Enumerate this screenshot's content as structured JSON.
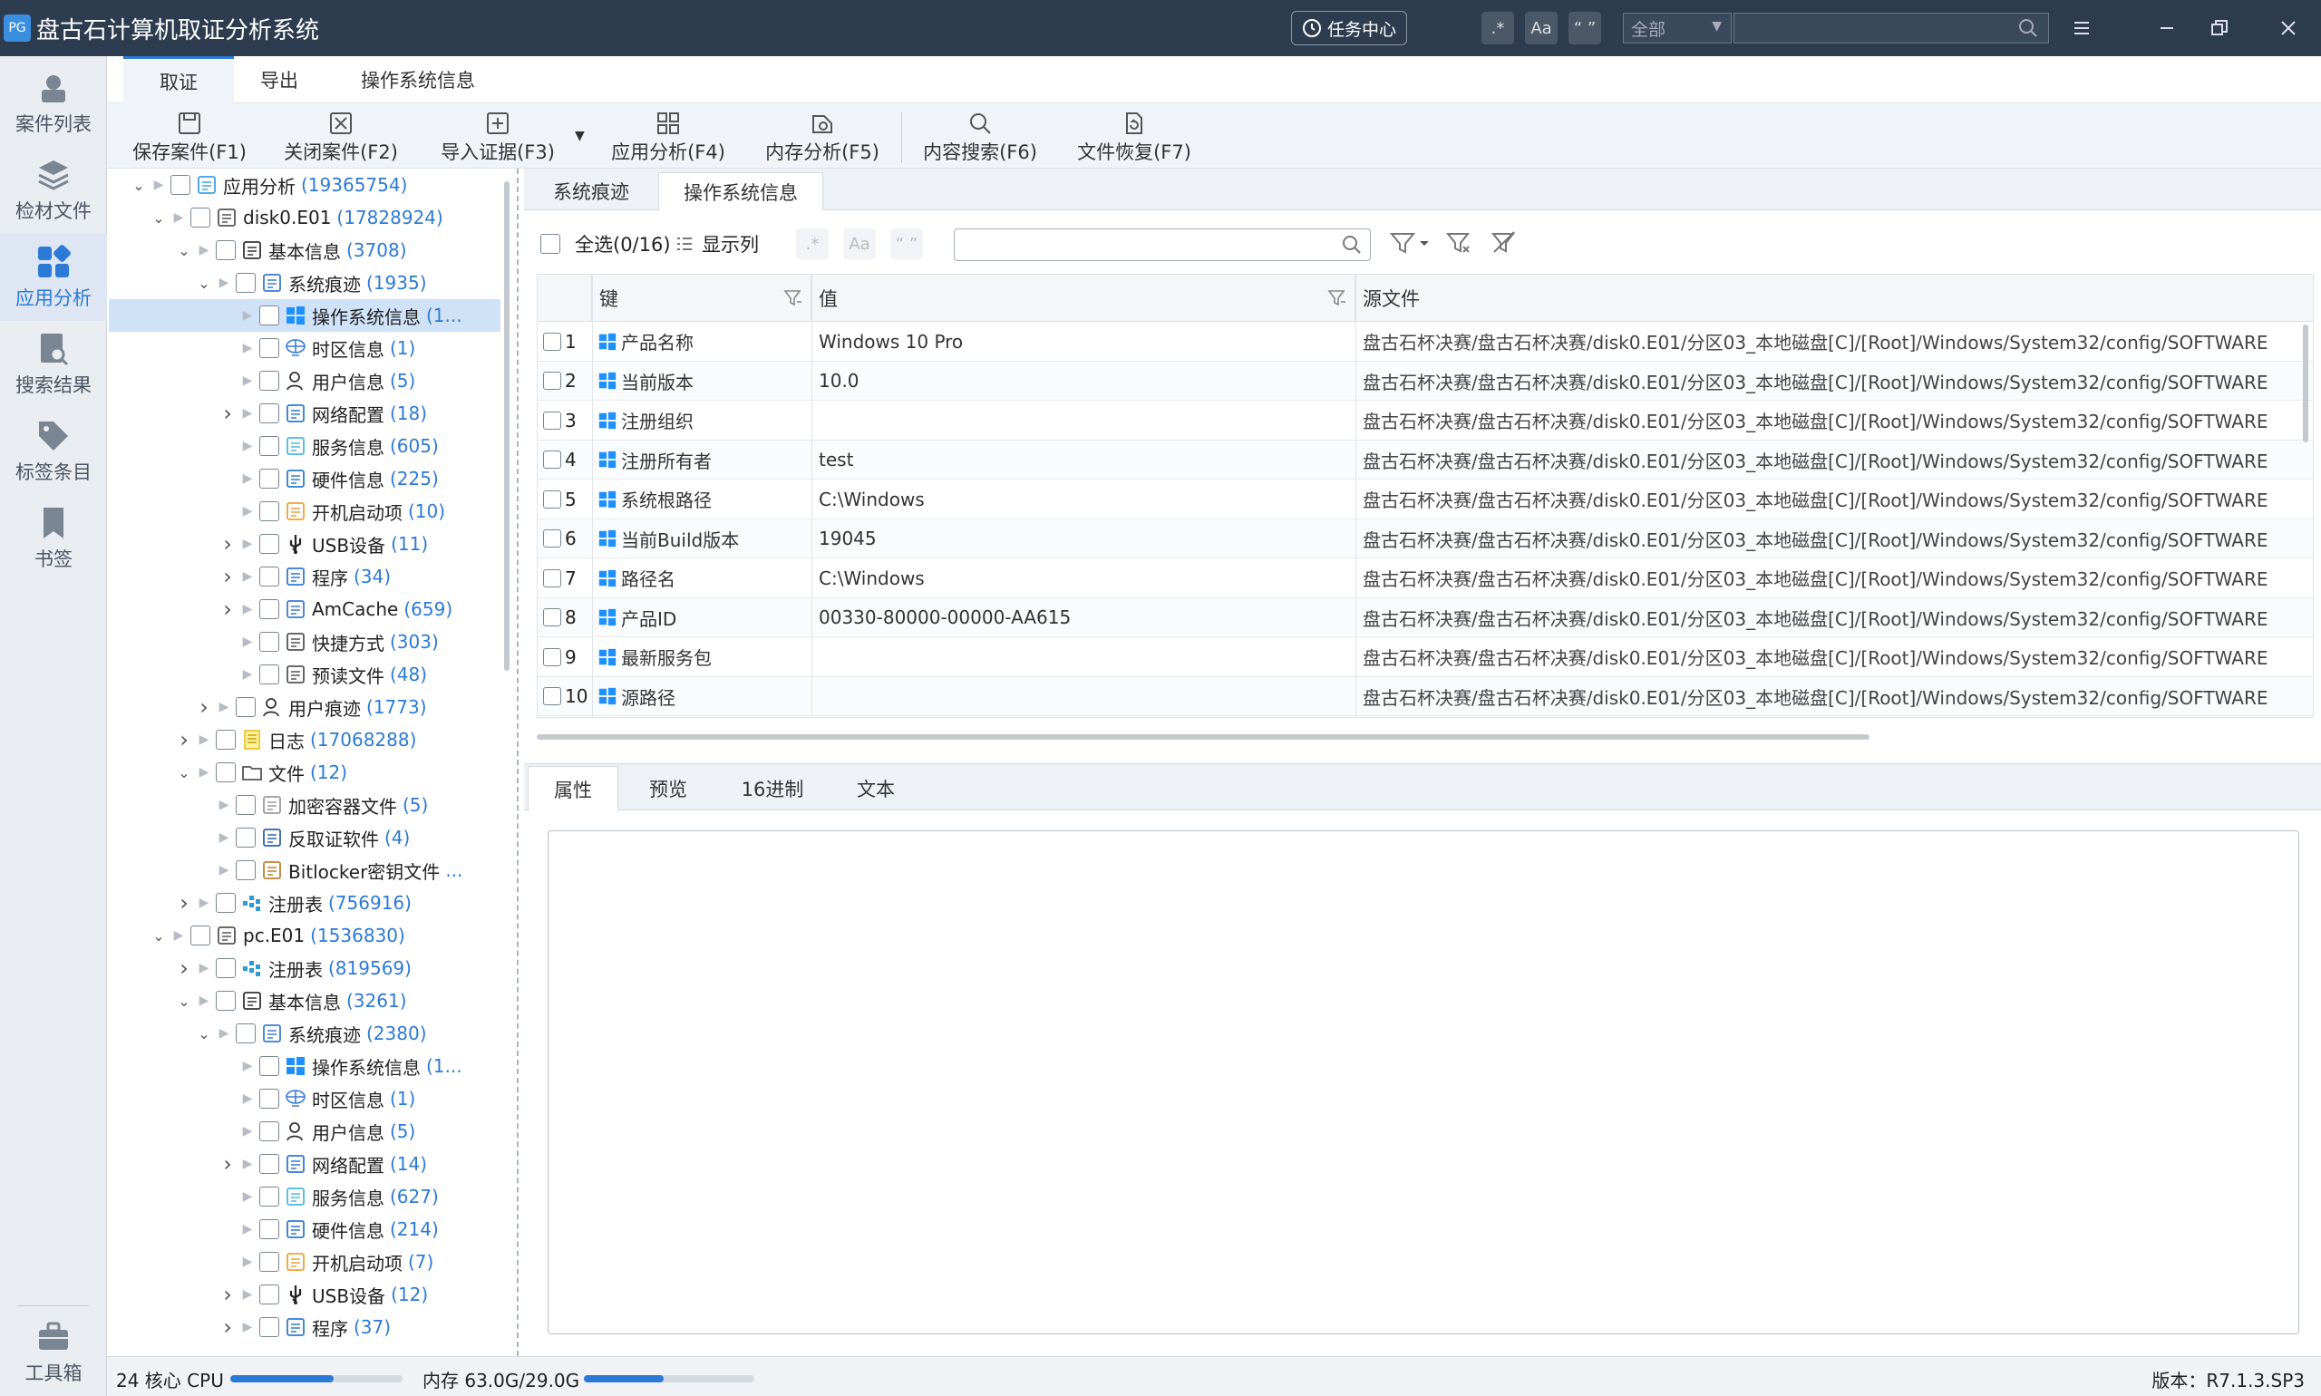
{
  "app": {
    "title": "盘古石计算机取证分析系统",
    "logo": "PG"
  },
  "titlebar": {
    "task_center": "任务中心",
    "opt_regex": ".*",
    "opt_case": "Aa",
    "opt_word": "“ ”",
    "scope": "全部",
    "search_value": ""
  },
  "leftnav": [
    {
      "label": "案件列表",
      "icon": "case-list-icon"
    },
    {
      "label": "检材文件",
      "icon": "layers-icon"
    },
    {
      "label": "应用分析",
      "icon": "apps-icon"
    },
    {
      "label": "搜索结果",
      "icon": "search-result-icon"
    },
    {
      "label": "标签条目",
      "icon": "tag-icon"
    },
    {
      "label": "书签",
      "icon": "bookmark-icon"
    },
    {
      "label": "工具箱",
      "icon": "toolbox-icon"
    }
  ],
  "ribbon": {
    "tabs": [
      "取证",
      "导出",
      "操作系统信息"
    ],
    "tools": [
      "保存案件(F1)",
      "关闭案件(F2)",
      "导入证据(F3)",
      "应用分析(F4)",
      "内存分析(F5)",
      "内容搜索(F6)",
      "文件恢复(F7)"
    ]
  },
  "tree": [
    {
      "label": "应用分析",
      "count": "(19365754)",
      "icon": "app-analysis-icon",
      "exp": "v"
    },
    {
      "label": "disk0.E01",
      "count": "(17828924)",
      "icon": "disk-image-icon",
      "exp": "v"
    },
    {
      "label": "基本信息",
      "count": "(3708)",
      "icon": "basic-info-icon",
      "exp": "v"
    },
    {
      "label": "系统痕迹",
      "count": "(1935)",
      "icon": "system-trace-icon",
      "exp": "v"
    },
    {
      "label": "操作系统信息",
      "count": "(1...",
      "icon": "windows-icon",
      "exp": ""
    },
    {
      "label": "时区信息",
      "count": "(1)",
      "icon": "globe-icon",
      "exp": ""
    },
    {
      "label": "用户信息",
      "count": "(5)",
      "icon": "user-icon",
      "exp": ""
    },
    {
      "label": "网络配置",
      "count": "(18)",
      "icon": "monitor-icon",
      "exp": ">"
    },
    {
      "label": "服务信息",
      "count": "(605)",
      "icon": "service-icon",
      "exp": ""
    },
    {
      "label": "硬件信息",
      "count": "(225)",
      "icon": "hardware-icon",
      "exp": ""
    },
    {
      "label": "开机启动项",
      "count": "(10)",
      "icon": "startup-icon",
      "exp": ""
    },
    {
      "label": "USB设备",
      "count": "(11)",
      "icon": "usb-icon",
      "exp": ">"
    },
    {
      "label": "程序",
      "count": "(34)",
      "icon": "program-icon",
      "exp": ">"
    },
    {
      "label": "AmCache",
      "count": "(659)",
      "icon": "amcache-icon",
      "exp": ">"
    },
    {
      "label": "快捷方式",
      "count": "(303)",
      "icon": "shortcut-icon",
      "exp": ""
    },
    {
      "label": "预读文件",
      "count": "(48)",
      "icon": "prefetch-icon",
      "exp": ""
    },
    {
      "label": "用户痕迹",
      "count": "(1773)",
      "icon": "user-trace-icon",
      "exp": ">"
    },
    {
      "label": "日志",
      "count": "(17068288)",
      "icon": "log-icon",
      "exp": ">"
    },
    {
      "label": "文件",
      "count": "(12)",
      "icon": "folder-icon",
      "exp": "v"
    },
    {
      "label": "加密容器文件",
      "count": "(5)",
      "icon": "lock-icon",
      "exp": ""
    },
    {
      "label": "反取证软件",
      "count": "(4)",
      "icon": "anti-forensic-icon",
      "exp": ""
    },
    {
      "label": "Bitlocker密钥文件",
      "count": "...",
      "icon": "key-icon",
      "exp": ""
    },
    {
      "label": "注册表",
      "count": "(756916)",
      "icon": "registry-icon",
      "exp": ">"
    },
    {
      "label": "pc.E01",
      "count": "(1536830)",
      "icon": "disk-image-icon",
      "exp": "v"
    },
    {
      "label": "注册表",
      "count": "(819569)",
      "icon": "registry-icon",
      "exp": ">"
    },
    {
      "label": "基本信息",
      "count": "(3261)",
      "icon": "basic-info-icon",
      "exp": "v"
    },
    {
      "label": "系统痕迹",
      "count": "(2380)",
      "icon": "system-trace-icon",
      "exp": "v"
    },
    {
      "label": "操作系统信息",
      "count": "(1...",
      "icon": "windows-icon",
      "exp": ""
    },
    {
      "label": "时区信息",
      "count": "(1)",
      "icon": "globe-icon",
      "exp": ""
    },
    {
      "label": "用户信息",
      "count": "(5)",
      "icon": "user-icon",
      "exp": ""
    },
    {
      "label": "网络配置",
      "count": "(14)",
      "icon": "monitor-icon",
      "exp": ">"
    },
    {
      "label": "服务信息",
      "count": "(627)",
      "icon": "service-icon",
      "exp": ""
    },
    {
      "label": "硬件信息",
      "count": "(214)",
      "icon": "hardware-icon",
      "exp": ""
    },
    {
      "label": "开机启动项",
      "count": "(7)",
      "icon": "startup-icon",
      "exp": ""
    },
    {
      "label": "USB设备",
      "count": "(12)",
      "icon": "usb-icon",
      "exp": ">"
    },
    {
      "label": "程序",
      "count": "(37)",
      "icon": "program-icon",
      "exp": ">"
    }
  ],
  "upper_tabs": [
    "系统痕迹",
    "操作系统信息"
  ],
  "filter": {
    "select_all": "全选(0/16)",
    "show_cols": "显示列",
    "opt_regex": ".*",
    "opt_case": "Aa",
    "opt_word": "“ ”",
    "value": ""
  },
  "table": {
    "columns": [
      "键",
      "值",
      "源文件"
    ],
    "rows": [
      {
        "n": "1",
        "key": "产品名称",
        "val": "Windows 10 Pro",
        "src": "盘古石杯决赛/盘古石杯决赛/disk0.E01/分区03_本地磁盘[C]/[Root]/Windows/System32/config/SOFTWARE"
      },
      {
        "n": "2",
        "key": "当前版本",
        "val": "10.0",
        "src": "盘古石杯决赛/盘古石杯决赛/disk0.E01/分区03_本地磁盘[C]/[Root]/Windows/System32/config/SOFTWARE"
      },
      {
        "n": "3",
        "key": "注册组织",
        "val": "",
        "src": "盘古石杯决赛/盘古石杯决赛/disk0.E01/分区03_本地磁盘[C]/[Root]/Windows/System32/config/SOFTWARE"
      },
      {
        "n": "4",
        "key": "注册所有者",
        "val": "test",
        "src": "盘古石杯决赛/盘古石杯决赛/disk0.E01/分区03_本地磁盘[C]/[Root]/Windows/System32/config/SOFTWARE"
      },
      {
        "n": "5",
        "key": "系统根路径",
        "val": "C:\\Windows",
        "src": "盘古石杯决赛/盘古石杯决赛/disk0.E01/分区03_本地磁盘[C]/[Root]/Windows/System32/config/SOFTWARE"
      },
      {
        "n": "6",
        "key": "当前Build版本",
        "val": "19045",
        "src": "盘古石杯决赛/盘古石杯决赛/disk0.E01/分区03_本地磁盘[C]/[Root]/Windows/System32/config/SOFTWARE"
      },
      {
        "n": "7",
        "key": "路径名",
        "val": "C:\\Windows",
        "src": "盘古石杯决赛/盘古石杯决赛/disk0.E01/分区03_本地磁盘[C]/[Root]/Windows/System32/config/SOFTWARE"
      },
      {
        "n": "8",
        "key": "产品ID",
        "val": "00330-80000-00000-AA615",
        "src": "盘古石杯决赛/盘古石杯决赛/disk0.E01/分区03_本地磁盘[C]/[Root]/Windows/System32/config/SOFTWARE"
      },
      {
        "n": "9",
        "key": "最新服务包",
        "val": "",
        "src": "盘古石杯决赛/盘古石杯决赛/disk0.E01/分区03_本地磁盘[C]/[Root]/Windows/System32/config/SOFTWARE"
      },
      {
        "n": "10",
        "key": "源路径",
        "val": "",
        "src": "盘古石杯决赛/盘古石杯决赛/disk0.E01/分区03_本地磁盘[C]/[Root]/Windows/System32/config/SOFTWARE"
      }
    ]
  },
  "lower_tabs": [
    "属性",
    "预览",
    "16进制",
    "文本"
  ],
  "status": {
    "cpu": "24 核心 CPU",
    "cpu_usage": 0.6,
    "mem": "内存 63.0G/29.0G",
    "mem_usage": 0.47,
    "version": "版本：R7.1.3.SP3"
  },
  "colors": {
    "accent": "#2d7ad6",
    "titlebar": "#2d3d4f",
    "windows_blue": "#1e90ff"
  }
}
